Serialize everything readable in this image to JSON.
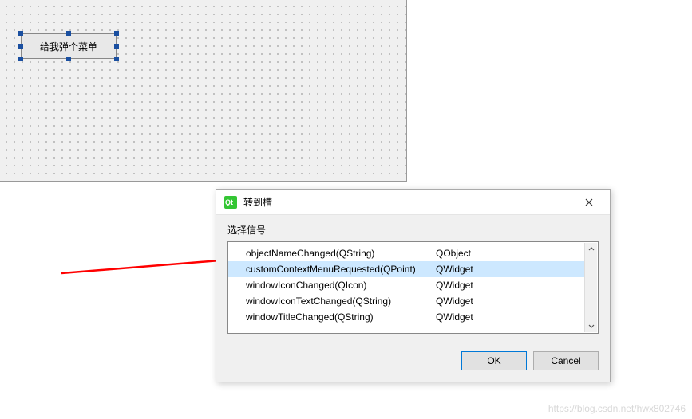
{
  "designer": {
    "button_text": "给我弹个菜单"
  },
  "dialog": {
    "title": "转到槽",
    "section_label": "选择信号",
    "signals": [
      {
        "signature": "objectNameChanged(QString)",
        "class": "QObject",
        "selected": false
      },
      {
        "signature": "customContextMenuRequested(QPoint)",
        "class": "QWidget",
        "selected": true
      },
      {
        "signature": "windowIconChanged(QIcon)",
        "class": "QWidget",
        "selected": false
      },
      {
        "signature": "windowIconTextChanged(QString)",
        "class": "QWidget",
        "selected": false
      },
      {
        "signature": "windowTitleChanged(QString)",
        "class": "QWidget",
        "selected": false
      }
    ],
    "ok_label": "OK",
    "cancel_label": "Cancel"
  },
  "watermark": "https://blog.csdn.net/hwx802746"
}
